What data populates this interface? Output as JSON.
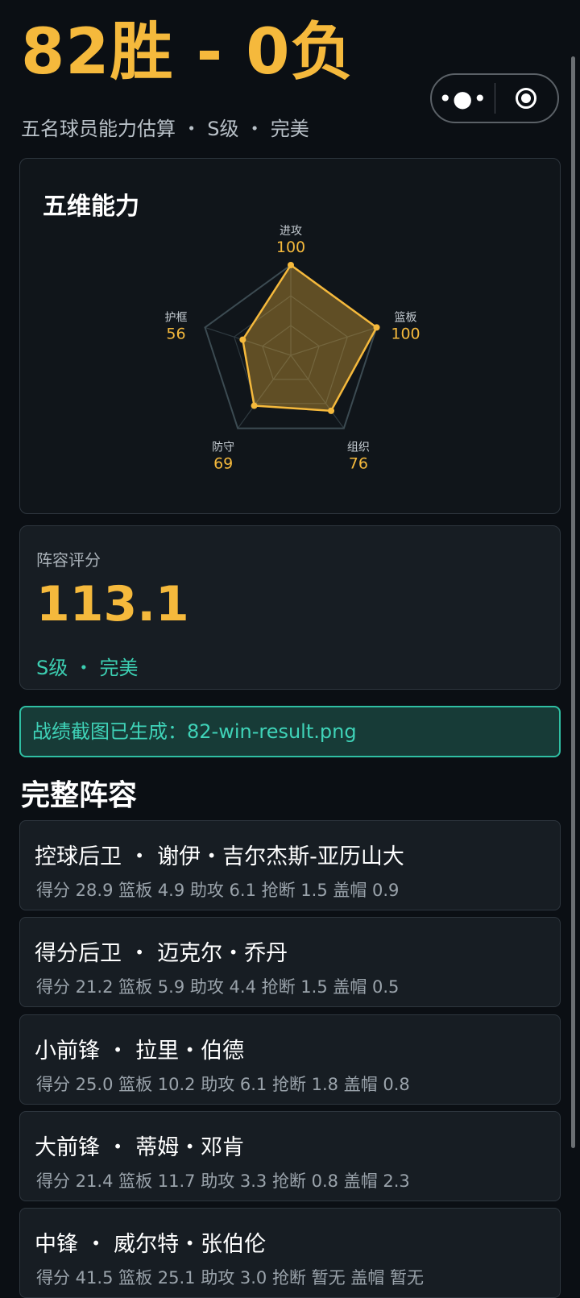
{
  "header": {
    "score": "82胜 - 0负",
    "subtitle": "五名球员能力估算 ・ S级 ・ 完美"
  },
  "capsule": {
    "more_icon": "more-dots-icon",
    "close_icon": "target-icon"
  },
  "radar": {
    "title": "五维能力",
    "axes": [
      {
        "label": "进攻",
        "value": 100
      },
      {
        "label": "篮板",
        "value": 100
      },
      {
        "label": "组织",
        "value": 76
      },
      {
        "label": "防守",
        "value": 69
      },
      {
        "label": "护框",
        "value": 56
      }
    ],
    "max": 100,
    "colors": {
      "accent": "#f5b93c",
      "grid": "#3c4b52"
    }
  },
  "rating": {
    "label": "阵容评分",
    "value": "113.1",
    "grade": "S级 ・ 完美"
  },
  "notice": {
    "text": "战绩截图已生成：82-win-result.png"
  },
  "roster": {
    "title": "完整阵容",
    "players": [
      {
        "name": "控球后卫 ・ 谢伊・吉尔杰斯-亚历山大",
        "stats": "得分 28.9  篮板 4.9  助攻 6.1  抢断 1.5  盖帽 0.9"
      },
      {
        "name": "得分后卫 ・ 迈克尔・乔丹",
        "stats": "得分 21.2  篮板 5.9  助攻 4.4  抢断 1.5  盖帽 0.5"
      },
      {
        "name": "小前锋 ・ 拉里・伯德",
        "stats": "得分 25.0  篮板 10.2  助攻 6.1  抢断 1.8  盖帽 0.8"
      },
      {
        "name": "大前锋 ・ 蒂姆・邓肯",
        "stats": "得分 21.4  篮板 11.7  助攻 3.3  抢断 0.8  盖帽 2.3"
      },
      {
        "name": "中锋 ・ 威尔特・张伯伦",
        "stats": "得分 41.5  篮板 25.1  助攻 3.0  抢断 暂无  盖帽 暂无"
      }
    ]
  },
  "colors": {
    "accent": "#f5b93c",
    "teal": "#3ccfb2",
    "background": "#0b0f14"
  }
}
